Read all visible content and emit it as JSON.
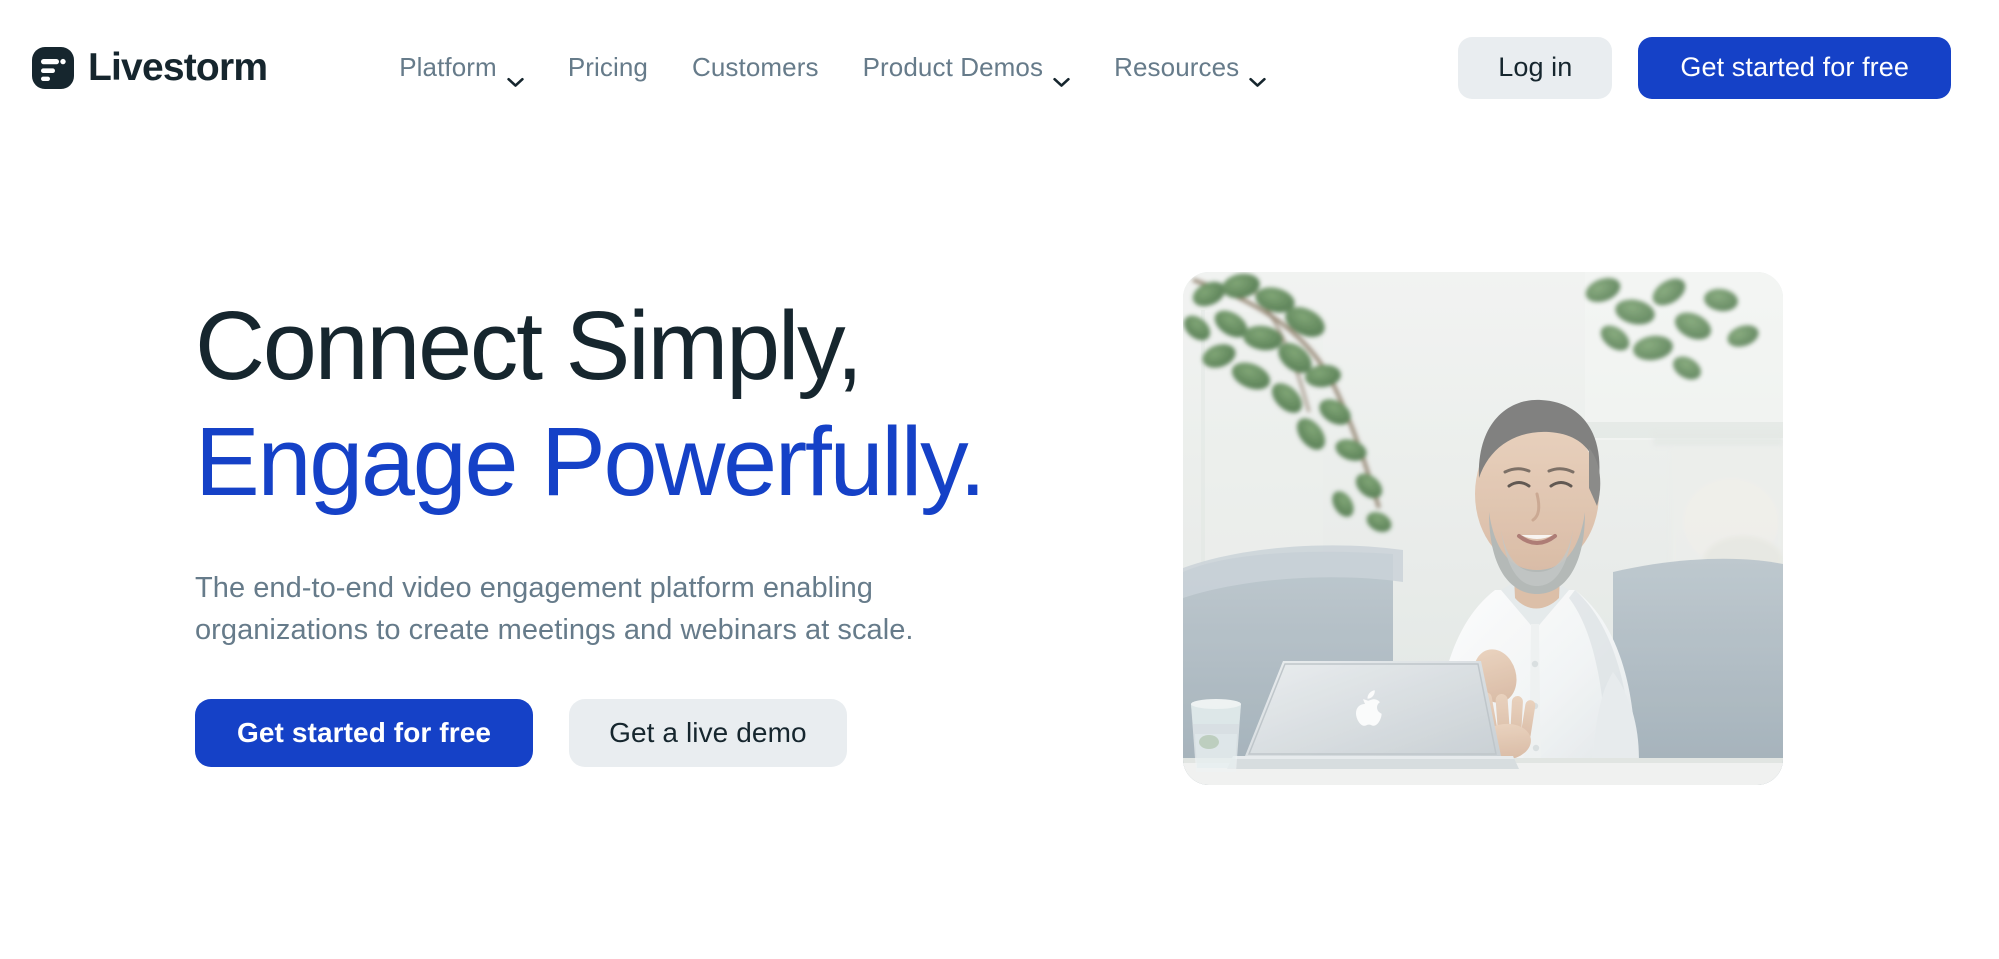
{
  "brand": {
    "name": "Livestorm",
    "logo_icon": "livestorm-logo-icon",
    "logo_color": "#16262e"
  },
  "nav": {
    "items": [
      {
        "label": "Platform",
        "has_dropdown": true,
        "icon": "chevron-down-icon"
      },
      {
        "label": "Pricing",
        "has_dropdown": false,
        "icon": ""
      },
      {
        "label": "Customers",
        "has_dropdown": false,
        "icon": ""
      },
      {
        "label": "Product Demos",
        "has_dropdown": true,
        "icon": "chevron-down-icon"
      },
      {
        "label": "Resources",
        "has_dropdown": true,
        "icon": "chevron-down-icon"
      }
    ],
    "text_color": "#667b8a"
  },
  "header_actions": {
    "login_label": "Log in",
    "signup_label": "Get started for free"
  },
  "hero": {
    "title_line1": "Connect Simply,",
    "title_line2": "Engage Powerfully.",
    "subtitle": "The end-to-end video engagement platform enabling organizations to create meetings and webinars at scale.",
    "primary_cta": "Get started for free",
    "secondary_cta": "Get a live demo",
    "image_alt": "Smiling bearded man in a white shirt sitting on a light grey sofa using a MacBook laptop in a bright white living room with hanging green plants and a glass of water on the table"
  },
  "colors": {
    "accent_blue": "#1541c7",
    "dark_slate": "#16262e",
    "muted_slate": "#667b8a",
    "ghost_button_bg": "#e9edf0",
    "page_background": "#ffffff"
  }
}
